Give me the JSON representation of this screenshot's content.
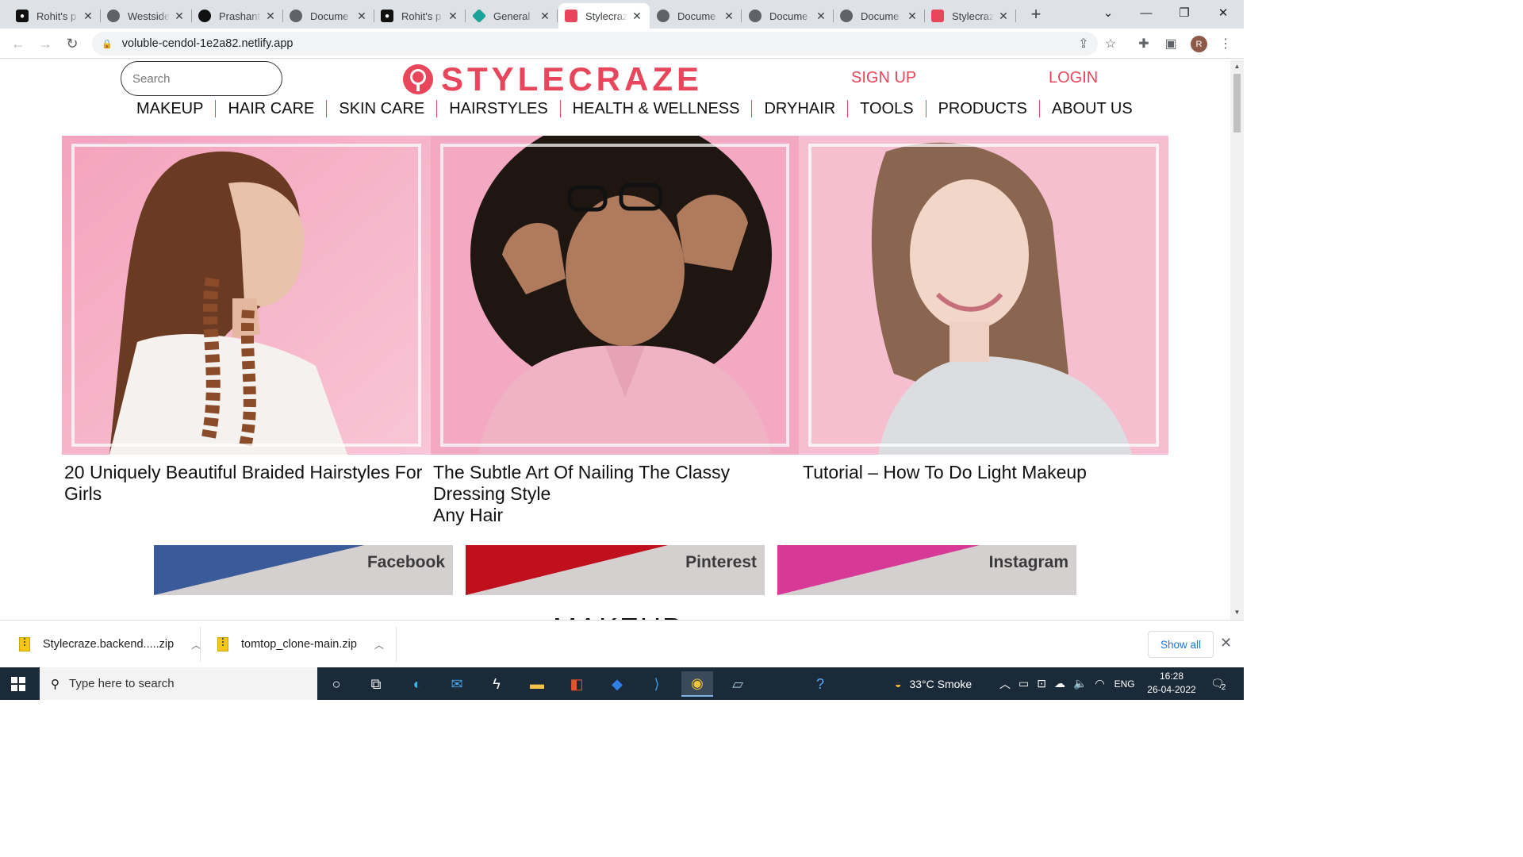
{
  "browser": {
    "tabs": [
      {
        "title": "Rohit's p",
        "favicon": "tab-app-icon",
        "color": "#111111"
      },
      {
        "title": "Westside",
        "favicon": "globe-icon",
        "color": "#5f6368"
      },
      {
        "title": "Prashant",
        "favicon": "github-icon",
        "color": "#111111"
      },
      {
        "title": "Docume",
        "favicon": "globe-icon",
        "color": "#5f6368"
      },
      {
        "title": "Rohit's p",
        "favicon": "tab-app-icon",
        "color": "#111111"
      },
      {
        "title": "General",
        "favicon": "diamond-icon",
        "color": "#1aa39a"
      },
      {
        "title": "Stylecraz",
        "favicon": "stylecraze-icon",
        "color": "#e8465a"
      },
      {
        "title": "Docume",
        "favicon": "globe-icon",
        "color": "#5f6368"
      },
      {
        "title": "Docume",
        "favicon": "globe-icon",
        "color": "#5f6368"
      },
      {
        "title": "Docume",
        "favicon": "globe-icon",
        "color": "#5f6368"
      },
      {
        "title": "Stylecraz",
        "favicon": "stylecraze-icon",
        "color": "#e8465a"
      }
    ],
    "active_tab_index": 6,
    "url": "voluble-cendol-1e2a82.netlify.app",
    "profile_initial": "R"
  },
  "site": {
    "search_placeholder": "Search",
    "logo_text": "STYLECRAZE",
    "brand_color": "#e8465a",
    "signup_label": "SIGN UP",
    "login_label": "LOGIN",
    "nav": [
      "MAKEUP",
      "HAIR CARE",
      "SKIN CARE",
      "HAIRSTYLES",
      "HEALTH & WELLNESS",
      "DRYHAIR",
      "TOOLS",
      "PRODUCTS",
      "ABOUT US"
    ],
    "articles": [
      {
        "line1": "20 Uniquely Beautiful Braided Hairstyles For",
        "line2": "Girls",
        "line3": ""
      },
      {
        "line1": "The Subtle Art Of Nailing The Classy",
        "line2": "Dressing Style",
        "line3": "Any Hair"
      },
      {
        "line1": "Tutorial – How To Do Light Makeup",
        "line2": "",
        "line3": ""
      }
    ],
    "social": [
      {
        "label": "Facebook",
        "color": "#3b5a9a"
      },
      {
        "label": "Pinterest",
        "color": "#c0101e"
      },
      {
        "label": "Instagram",
        "color": "#d63a96"
      }
    ],
    "section_heading_partial": "MAKEUP"
  },
  "downloads": {
    "items": [
      "Stylecraze.backend.....zip",
      "tomtop_clone-main.zip"
    ],
    "show_all_label": "Show all"
  },
  "taskbar": {
    "search_placeholder": "Type here to search",
    "weather": "33°C  Smoke",
    "language": "ENG",
    "time": "16:28",
    "date": "26-04-2022",
    "notification_count": "2"
  }
}
